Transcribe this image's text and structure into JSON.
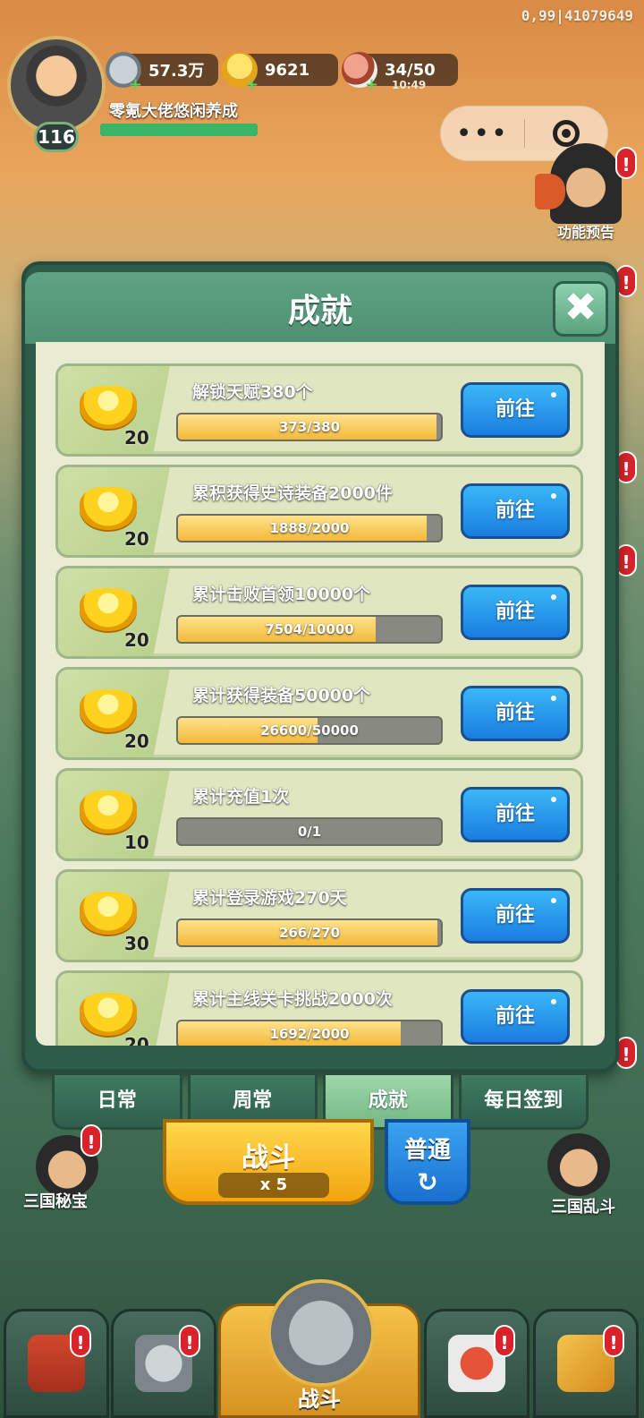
{
  "debug_text": "0,99|41079649",
  "player": {
    "level": "116",
    "name": "零氪大佬悠闲养成",
    "xp_fraction": 1.0
  },
  "resources": {
    "silver": "57.3万",
    "gold": "9621",
    "stamina": "34/50",
    "stamina_timer": "10:49"
  },
  "capsule": {
    "more_icon": "•••",
    "close_icon": "target-circle-icon"
  },
  "feature_preview": {
    "label": "功能预告"
  },
  "modal": {
    "title": "成就",
    "close_label": "✖",
    "items": [
      {
        "title": "解锁天赋380个",
        "reward": "20",
        "progress": "373/380",
        "fraction": 0.982,
        "button": "前往"
      },
      {
        "title": "累积获得史诗装备2000件",
        "reward": "20",
        "progress": "1888/2000",
        "fraction": 0.944,
        "button": "前往"
      },
      {
        "title": "累计击败首领10000个",
        "reward": "20",
        "progress": "7504/10000",
        "fraction": 0.75,
        "button": "前往"
      },
      {
        "title": "累计获得装备50000个",
        "reward": "20",
        "progress": "26600/50000",
        "fraction": 0.532,
        "button": "前往"
      },
      {
        "title": "累计充值1次",
        "reward": "10",
        "progress": "0/1",
        "fraction": 0.0,
        "button": "前往"
      },
      {
        "title": "累计登录游戏270天",
        "reward": "30",
        "progress": "266/270",
        "fraction": 0.985,
        "button": "前往"
      },
      {
        "title": "累计主线关卡挑战2000次",
        "reward": "20",
        "progress": "1692/2000",
        "fraction": 0.846,
        "button": "前往"
      }
    ],
    "tabs": [
      "日常",
      "周常",
      "成就",
      "每日签到"
    ],
    "active_tab": 2
  },
  "below": {
    "left_label": "三国秘宝",
    "right_label": "三国乱斗",
    "fight_label": "战斗",
    "fight_cost": "x 5",
    "mode_label": "普通",
    "mode_icon": "↻"
  },
  "bottom_nav": {
    "center_label": "战斗"
  },
  "colors": {
    "accent_green": "#4f8f72",
    "go_button": "#1a7de0",
    "progress_fill": "#f3b93a",
    "alert_red": "#d8232a"
  }
}
